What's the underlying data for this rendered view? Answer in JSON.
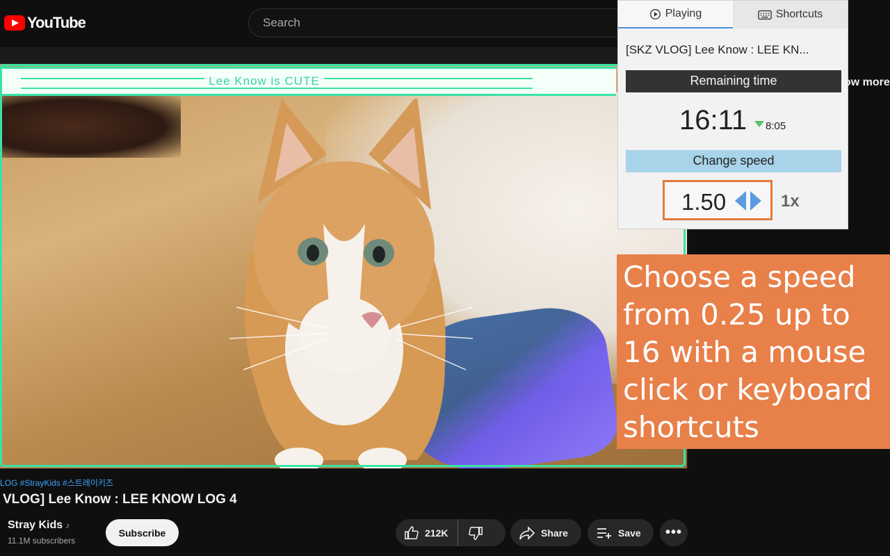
{
  "app": {
    "logo_text": "YouTube"
  },
  "search": {
    "placeholder": "Search"
  },
  "video": {
    "caption": "Lee Know is CUTE",
    "hashtags": "LOG #StrayKids #스트레이키즈",
    "title": "VLOG] Lee Know : LEE KNOW LOG 4",
    "channel": "Stray Kids",
    "subscribers": "11.1M subscribers",
    "subscribe_label": "Subscribe",
    "likes": "212K",
    "share_label": "Share",
    "save_label": "Save",
    "more_label": "•••",
    "show_more": "ow more"
  },
  "popup": {
    "tabs": [
      {
        "label": "Playing"
      },
      {
        "label": "Shortcuts"
      }
    ],
    "title": "[SKZ VLOG] Lee Know : LEE KN...",
    "remaining_label": "Remaining time",
    "remaining_time": "16:11",
    "saved_time": "8:05",
    "change_speed_label": "Change speed",
    "speed_value": "1.50",
    "reset_label": "1x",
    "colors": {
      "speed_border": "#e37a40",
      "arrows": "#5b9be0",
      "change_bar": "#a8d3e9"
    }
  },
  "callout": {
    "text": "Choose a speed from 0.25 up to 16 with a mouse click or keyboard shortcuts",
    "color": "#e8804a"
  }
}
